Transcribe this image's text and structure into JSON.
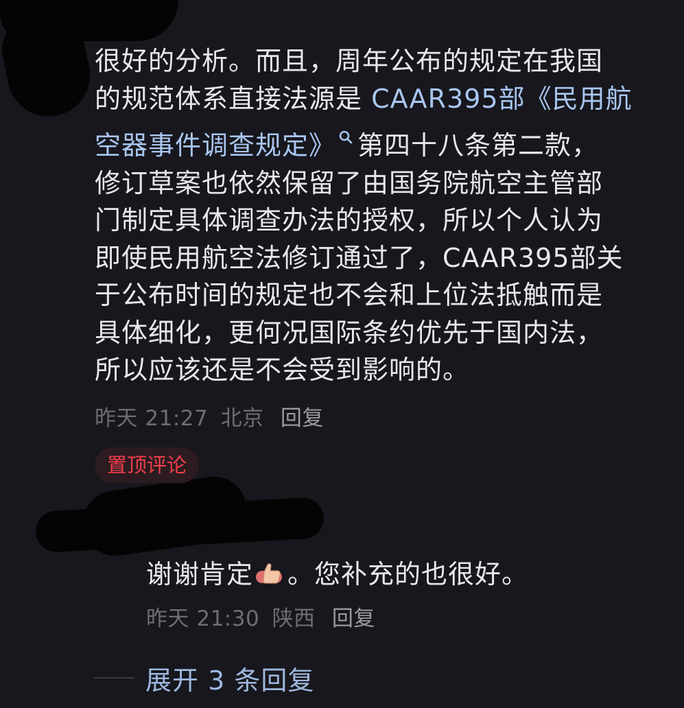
{
  "comment": {
    "lines": [
      [
        "很好的分析。而且，周年公布的规定在我国"
      ],
      [
        "的规范体系直接法源是 ",
        "CAAR395部《民用航"
      ],
      [
        "空器事件调查规定》",
        "第四十八条第二款，"
      ],
      [
        "修订草案也依然保留了由国务院航空主管部"
      ],
      [
        "门制定具体调查办法的授权，所以个人认为"
      ],
      [
        "即使民用航空法修订通过了，CAAR395部关"
      ],
      [
        "于公布时间的规定也不会和上位法抵触而是"
      ],
      [
        "具体细化，更何况国际条约优先于国内法，"
      ],
      [
        "所以应该还是不会受到影响的。"
      ]
    ],
    "time": "昨天 21:27",
    "location": "北京",
    "reply_label": "回复",
    "pinned_badge": "置顶评论"
  },
  "reply": {
    "text_before_emoji": "谢谢肯定",
    "emoji": "thumbs-up-emoji",
    "text_after_emoji": "。您补充的也很好。",
    "time": "昨天 21:30",
    "location": "陕西",
    "reply_label": "回复"
  },
  "expand_replies": {
    "label": "展开 3 条回复"
  },
  "colors": {
    "background": "#17171d",
    "text": "#e8e8ec",
    "link": "#a9c6f0",
    "meta": "#6d6d75",
    "pinned": "#ee3f4a",
    "pinned_bg": "#2c1b20",
    "expand": "#9fb8de"
  }
}
